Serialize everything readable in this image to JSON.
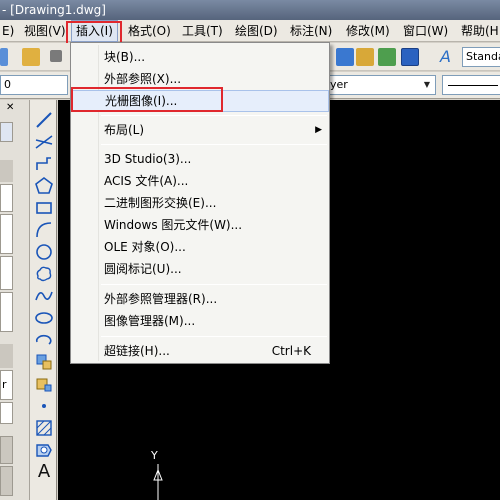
{
  "window": {
    "title": "- [Drawing1.dwg]"
  },
  "menubar": {
    "items": [
      {
        "label": "E)"
      },
      {
        "label": "视图(V)"
      },
      {
        "label": "插入(I)"
      },
      {
        "label": "格式(O)"
      },
      {
        "label": "工具(T)"
      },
      {
        "label": "绘图(D)"
      },
      {
        "label": "标注(N)"
      },
      {
        "label": "修改(M)"
      },
      {
        "label": "窗口(W)"
      },
      {
        "label": "帮助(H"
      }
    ]
  },
  "toolbar": {
    "style_combo": "Standa",
    "layer_combo": "0",
    "linetype_combo": "yer"
  },
  "insert_menu": {
    "items": [
      {
        "label": "块(B)..."
      },
      {
        "label": "外部参照(X)..."
      },
      {
        "label": "光栅图像(I)..."
      },
      {
        "label": "布局(L)"
      },
      {
        "label": "3D Studio(3)..."
      },
      {
        "label": "ACIS 文件(A)..."
      },
      {
        "label": "二进制图形交换(E)..."
      },
      {
        "label": "Windows 图元文件(W)..."
      },
      {
        "label": "OLE 对象(O)..."
      },
      {
        "label": "圆阅标记(U)..."
      },
      {
        "label": "外部参照管理器(R)..."
      },
      {
        "label": "图像管理器(M)..."
      },
      {
        "label": "超链接(H)...",
        "shortcut": "Ctrl+K"
      }
    ]
  },
  "palette": {
    "labels": [
      "r"
    ]
  },
  "canvas": {
    "ucs_label": "Y"
  },
  "drawbar": {
    "text_tool_label": "A"
  },
  "colors": {
    "highlight": "#e0282e",
    "canvas": "#000000"
  }
}
